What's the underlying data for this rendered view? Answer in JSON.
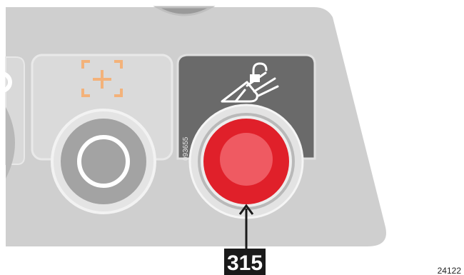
{
  "callout": {
    "number": "315"
  },
  "figure_code": "24122",
  "panel_serial": "093655",
  "icons": {
    "left_panel": "focus-plus-icon",
    "right_panel": "horn-unlock-icon"
  },
  "colors": {
    "panel_grey": "#cfcfcf",
    "dark_panel": "#6a6a6a",
    "red_button": "#e0202a",
    "orange_icon": "#f3b27a"
  }
}
